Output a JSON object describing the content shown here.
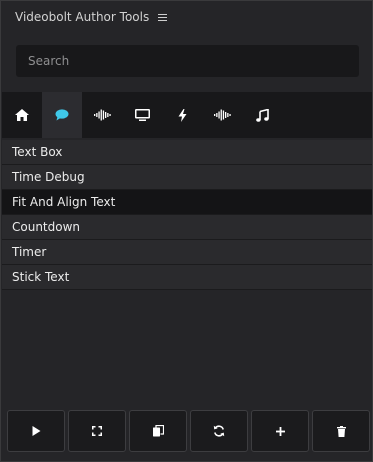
{
  "panel": {
    "title": "Videobolt Author Tools"
  },
  "search": {
    "placeholder": "Search",
    "value": ""
  },
  "toolbar": {
    "tools": [
      {
        "icon": "home-icon",
        "active": false
      },
      {
        "icon": "chat-bubble-icon",
        "active": true
      },
      {
        "icon": "audio-waveform-icon",
        "active": false
      },
      {
        "icon": "monitor-icon",
        "active": false
      },
      {
        "icon": "lightning-bolt-icon",
        "active": false
      },
      {
        "icon": "audio-waveform-icon",
        "active": false
      },
      {
        "icon": "music-note-icon",
        "active": false
      }
    ]
  },
  "list": {
    "items": [
      {
        "label": "Text Box"
      },
      {
        "label": "Time Debug"
      },
      {
        "label": "Fit And Align Text",
        "selected": true
      },
      {
        "label": "Countdown"
      },
      {
        "label": "Timer"
      },
      {
        "label": "Stick Text"
      }
    ]
  },
  "bottom_bar": {
    "buttons": [
      "play-icon",
      "fullscreen-icon",
      "copy-icon",
      "refresh-icon",
      "plus-icon",
      "trash-icon"
    ]
  },
  "colors": {
    "accent": "#3fc8e8",
    "icon": "#ffffff",
    "panel_bg": "#252528",
    "toolbar_bg": "#18181a"
  }
}
